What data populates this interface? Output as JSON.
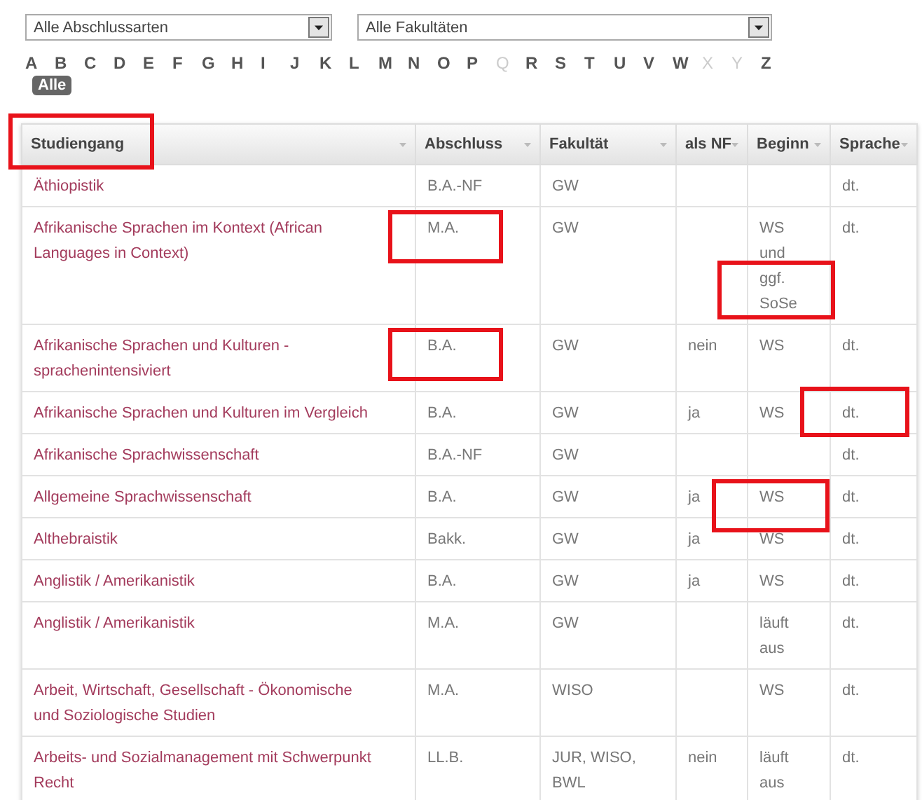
{
  "filters": [
    {
      "value": "Alle Abschlussarten"
    },
    {
      "value": "Alle Fakultäten"
    }
  ],
  "alphabet": [
    {
      "label": "A",
      "disabled": false
    },
    {
      "label": "B",
      "disabled": false
    },
    {
      "label": "C",
      "disabled": false
    },
    {
      "label": "D",
      "disabled": false
    },
    {
      "label": "E",
      "disabled": false
    },
    {
      "label": "F",
      "disabled": false
    },
    {
      "label": "G",
      "disabled": false
    },
    {
      "label": "H",
      "disabled": false
    },
    {
      "label": "I",
      "disabled": false
    },
    {
      "label": "J",
      "disabled": false
    },
    {
      "label": "K",
      "disabled": false
    },
    {
      "label": "L",
      "disabled": false
    },
    {
      "label": "M",
      "disabled": false
    },
    {
      "label": "N",
      "disabled": false
    },
    {
      "label": "O",
      "disabled": false
    },
    {
      "label": "P",
      "disabled": false
    },
    {
      "label": "Q",
      "disabled": true
    },
    {
      "label": "R",
      "disabled": false
    },
    {
      "label": "S",
      "disabled": false
    },
    {
      "label": "T",
      "disabled": false
    },
    {
      "label": "U",
      "disabled": false
    },
    {
      "label": "V",
      "disabled": false
    },
    {
      "label": "W",
      "disabled": false
    },
    {
      "label": "X",
      "disabled": true
    },
    {
      "label": "Y",
      "disabled": true
    },
    {
      "label": "Z",
      "disabled": false
    }
  ],
  "all_filter": {
    "label": "Alle",
    "selected": true
  },
  "table": {
    "columns": [
      {
        "label": "Studiengang",
        "marked": true
      },
      {
        "label": "Abschluss",
        "marked": false
      },
      {
        "label": "Fakultät",
        "marked": false
      },
      {
        "label": "als NF",
        "marked": false
      },
      {
        "label": "Beginn",
        "marked": false
      },
      {
        "label": "Sprache",
        "marked": false
      }
    ],
    "rows": [
      {
        "cells": [
          "Äthiopistik",
          "B.A.-NF",
          "GW",
          "",
          "",
          "dt."
        ],
        "marked": [
          false,
          false,
          false,
          false,
          false,
          false
        ]
      },
      {
        "cells": [
          "Afrikanische Sprachen im Kontext (African Languages in Context)",
          "M.A.",
          "GW",
          "",
          "WS und ggf. SoSe",
          "dt."
        ],
        "marked": [
          false,
          true,
          false,
          false,
          true,
          false
        ]
      },
      {
        "cells": [
          "Afrikanische Sprachen und Kulturen - sprachenintensiviert",
          "B.A.",
          "GW",
          "nein",
          "WS",
          "dt."
        ],
        "marked": [
          false,
          true,
          false,
          false,
          false,
          false
        ]
      },
      {
        "cells": [
          "Afrikanische Sprachen und Kulturen im Vergleich",
          "B.A.",
          "GW",
          "ja",
          "WS",
          "dt."
        ],
        "marked": [
          false,
          false,
          false,
          false,
          false,
          true
        ]
      },
      {
        "cells": [
          "Afrikanische Sprachwissenschaft",
          "B.A.-NF",
          "GW",
          "",
          "",
          "dt."
        ],
        "marked": [
          false,
          false,
          false,
          false,
          false,
          false
        ]
      },
      {
        "cells": [
          "Allgemeine Sprachwissenschaft",
          "B.A.",
          "GW",
          "ja",
          "WS",
          "dt."
        ],
        "marked": [
          false,
          false,
          false,
          false,
          true,
          false
        ]
      },
      {
        "cells": [
          "Althebraistik",
          "Bakk.",
          "GW",
          "ja",
          "WS",
          "dt."
        ],
        "marked": [
          false,
          false,
          false,
          false,
          false,
          false
        ]
      },
      {
        "cells": [
          "Anglistik / Amerikanistik",
          "B.A.",
          "GW",
          "ja",
          "WS",
          "dt."
        ],
        "marked": [
          false,
          false,
          false,
          false,
          false,
          false
        ]
      },
      {
        "cells": [
          "Anglistik / Amerikanistik",
          "M.A.",
          "GW",
          "",
          "läuft aus",
          "dt."
        ],
        "marked": [
          false,
          false,
          false,
          false,
          false,
          false
        ]
      },
      {
        "cells": [
          "Arbeit, Wirtschaft, Gesellschaft - Ökonomische und Soziologische Studien",
          "M.A.",
          "WISO",
          "",
          "WS",
          "dt."
        ],
        "marked": [
          false,
          false,
          false,
          false,
          false,
          false
        ]
      },
      {
        "cells": [
          "Arbeits- und Sozialmanagement mit Schwerpunkt Recht",
          "LL.B.",
          "JUR, WISO, BWL",
          "nein",
          "läuft aus",
          "dt."
        ],
        "marked": [
          false,
          false,
          false,
          false,
          false,
          false
        ]
      }
    ]
  }
}
